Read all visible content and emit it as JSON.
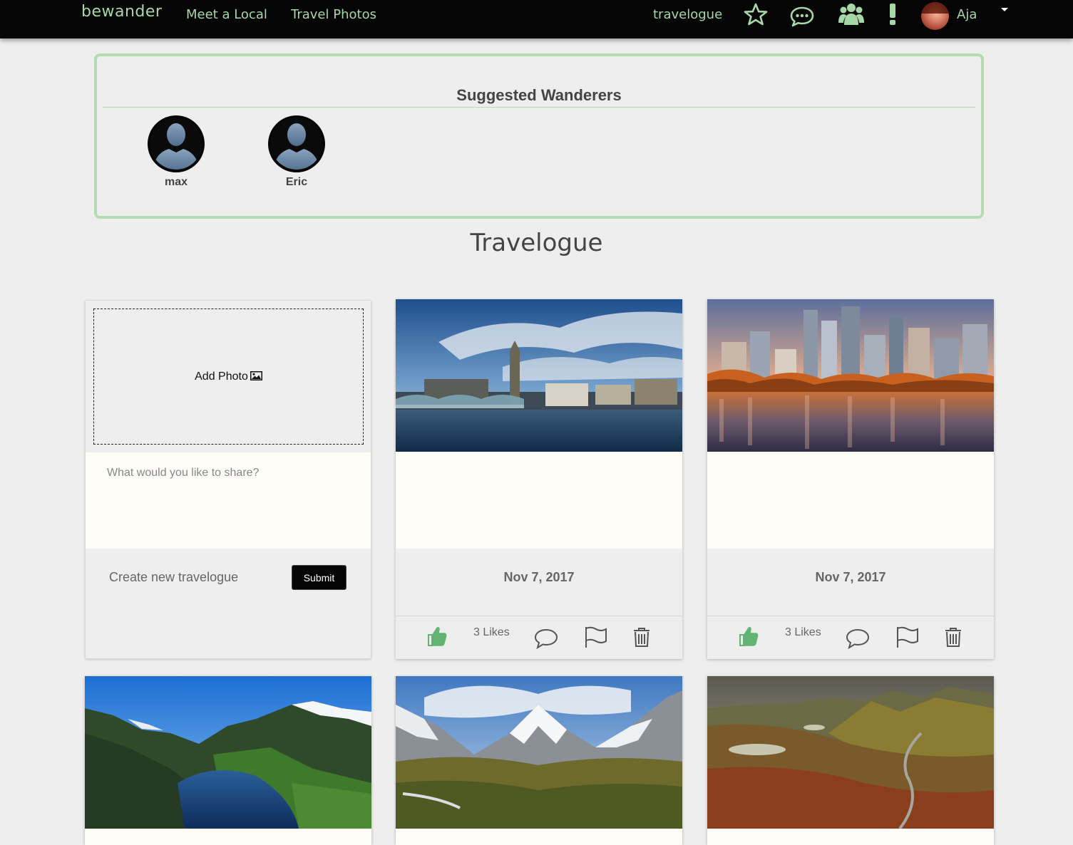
{
  "nav": {
    "brand": "bewander",
    "links": [
      "Meet a Local",
      "Travel Photos"
    ],
    "travelogue_link": "travelogue",
    "icons": [
      "star-icon",
      "chat-icon",
      "group-icon",
      "alert-icon"
    ],
    "user_name": "Aja",
    "accent_color": "#a7d7a7"
  },
  "suggested": {
    "title": "Suggested Wanderers",
    "users": [
      {
        "name": "max"
      },
      {
        "name": "Eric"
      }
    ]
  },
  "page_title": "Travelogue",
  "new_travelogue": {
    "add_photo_label": "Add Photo",
    "share_placeholder": "What would you like to share?",
    "create_label": "Create new travelogue",
    "submit_label": "Submit"
  },
  "posts": [
    {
      "photo": "london-thames-bridge",
      "date": "Nov 7, 2017",
      "likes_label": "3 Likes"
    },
    {
      "photo": "vancouver-skyline-autumn",
      "date": "Nov 7, 2017",
      "likes_label": "3 Likes"
    },
    {
      "photo": "norwegian-fjord"
    },
    {
      "photo": "snowy-mountain-valley"
    },
    {
      "photo": "highland-landscape-road"
    }
  ]
}
